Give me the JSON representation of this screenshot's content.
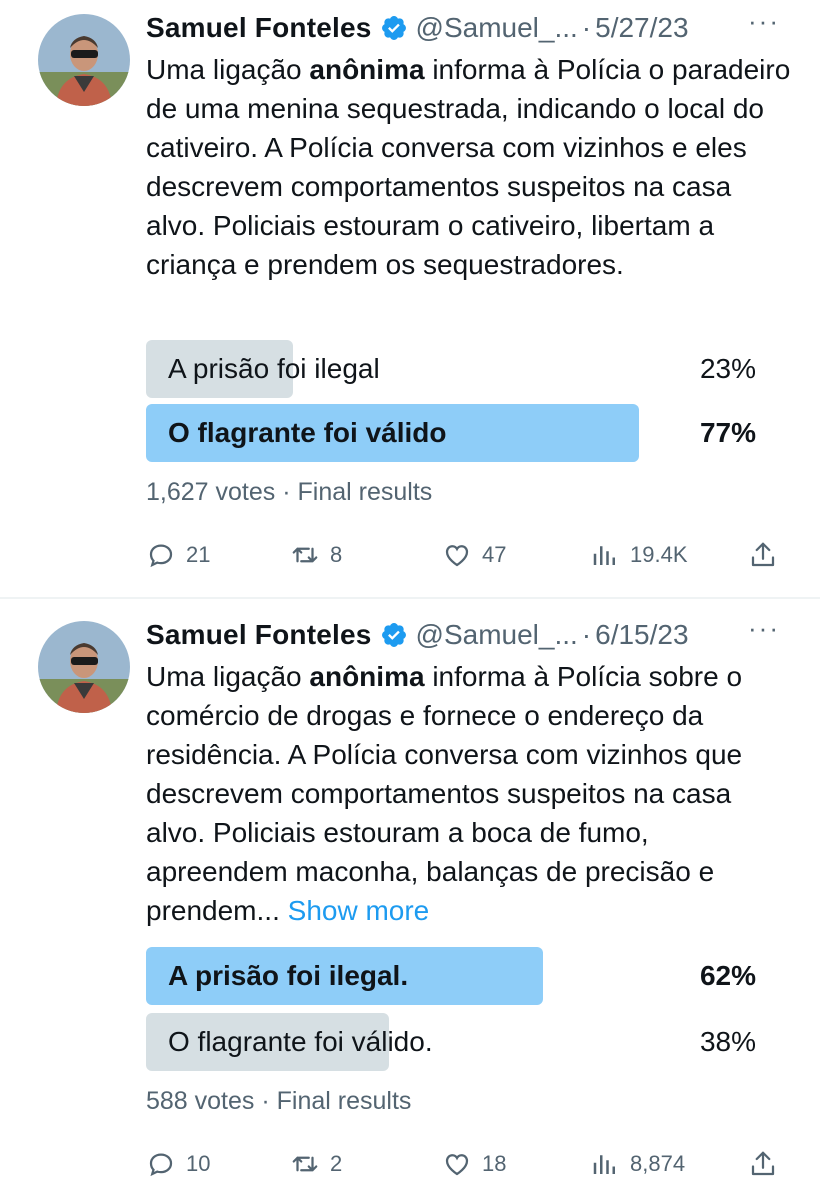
{
  "tweets": [
    {
      "author": "Samuel Fonteles",
      "handle": "@Samuel_...",
      "separator": "·",
      "date": "5/27/23",
      "more": "···",
      "text": {
        "part1": "Uma ligação ",
        "bold": "anônima",
        "part2": " informa à Polícia o paradeiro de uma menina sequestrada, indicando o local do cativeiro. A Polícia conversa com vizinhos e eles descrevem comportamentos suspeitos na casa alvo. Policiais estouram o cativeiro, libertam a criança e prendem os sequestradores.",
        "show_more": ""
      },
      "poll": {
        "options": [
          {
            "label": "A prisão foi ilegal",
            "percent": "23%",
            "fraction": 0.23,
            "winner": false
          },
          {
            "label": "O flagrante foi válido",
            "percent": "77%",
            "fraction": 0.77,
            "winner": true
          }
        ],
        "votes": "1,627 votes",
        "status": "Final results"
      },
      "stats": {
        "replies": "21",
        "retweets": "8",
        "likes": "47",
        "views": "19.4K"
      }
    },
    {
      "author": "Samuel Fonteles",
      "handle": "@Samuel_...",
      "separator": "·",
      "date": "6/15/23",
      "more": "···",
      "text": {
        "part1": "Uma ligação ",
        "bold": "anônima",
        "part2": " informa à Polícia sobre o comércio de drogas e fornece o endereço da residência. A Polícia conversa com vizinhos que descrevem comportamentos suspeitos na casa alvo. Policiais estouram a boca de fumo, apreendem maconha, balanças de precisão e prendem...",
        "show_more": "Show more"
      },
      "poll": {
        "options": [
          {
            "label": "A prisão foi ilegal.",
            "percent": "62%",
            "fraction": 0.62,
            "winner": true
          },
          {
            "label": "O flagrante foi válido.",
            "percent": "38%",
            "fraction": 0.38,
            "winner": false
          }
        ],
        "votes": "588 votes",
        "status": "Final results"
      },
      "stats": {
        "replies": "10",
        "retweets": "2",
        "likes": "18",
        "views": "8,874"
      }
    }
  ],
  "colors": {
    "accent": "#1d9bf0",
    "winner_bar": "#8ecdf8",
    "loser_bar": "#cfd9de",
    "muted_text": "#536471"
  },
  "icons": [
    "verified-badge-icon",
    "more-icon",
    "reply-icon",
    "retweet-icon",
    "like-icon",
    "views-icon",
    "share-icon"
  ]
}
